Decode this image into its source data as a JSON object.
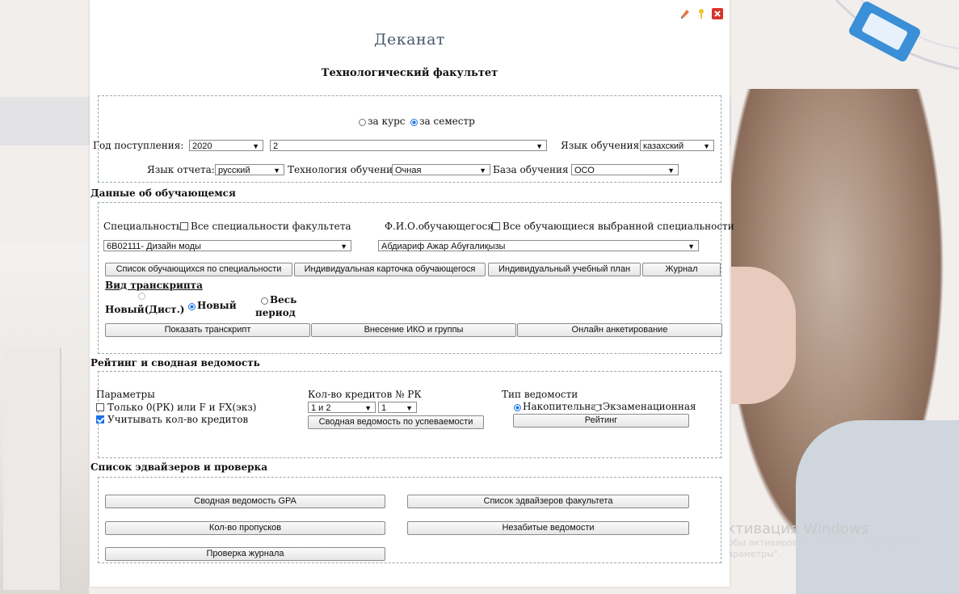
{
  "header": {
    "title": "Деканат",
    "faculty": "Технологический факультет",
    "icons": [
      "pencil-icon",
      "help-icon",
      "close-icon"
    ],
    "close_color": "#d9322a"
  },
  "filters": {
    "period_options": [
      "за курс",
      "за семестр"
    ],
    "period_selected": "за семестр",
    "year_label": "Год поступления:",
    "year_value": "2020",
    "course_value": "2",
    "study_lang_label": "Язык обучения:",
    "study_lang_value": "казахский",
    "report_lang_label": "Язык отчета:",
    "report_lang_value": "русский",
    "tech_label": "Технология обучения",
    "tech_value": "Очная",
    "base_label": "База обучения",
    "base_value": "ОСО"
  },
  "students": {
    "section_title": "Данные об обучающемся",
    "specialty_label": "Специальность",
    "all_specialties_label": "Все специальности факультета",
    "fio_label": "Ф.И.О.обучающегося",
    "all_students_label": "Все обучающиеся выбранной специальности",
    "specialty_value": "6В02111- Дизайн моды",
    "student_value": "Абдиариф Ажар Абуғалиқызы",
    "buttons": [
      "Список обучающихся по специальности",
      "Индивидуальная карточка обучающегося",
      "Индивидуальный учебный план",
      "Журнал"
    ],
    "transcript_title": "Вид транскрипта",
    "transcript_new_dist": "Новый(Дист.)",
    "transcript_new": "Новый",
    "transcript_all_line1": "Весь",
    "transcript_all_line2": "период",
    "transcript_selected": "Новый",
    "buttons2": [
      "Показать транскрипт",
      "Внесение ИКО и группы",
      "Онлайн анкетирование"
    ]
  },
  "rating": {
    "section_title": "Рейтинг и сводная ведомость",
    "params_label": "Параметры",
    "only_zero_label": "Только 0(РК) или F и FX(экз)",
    "only_zero_checked": false,
    "count_credits_label": "Учитывать кол-во кредитов",
    "count_credits_checked": true,
    "credits_label": "Кол-во кредитов № РК",
    "credits_value": "1 и 2",
    "rk_value": "1",
    "summary_button": "Сводная ведомость по успеваемости",
    "type_label": "Тип ведомости",
    "type_options": [
      "Накопительная",
      "Экзаменационная"
    ],
    "type_selected": "Накопительная",
    "rating_button": "Рейтинг"
  },
  "advisers": {
    "section_title": "Список эдвайзеров и проверка",
    "buttons": [
      "Сводная ведомость GPA",
      "Список эдвайзеров факультета",
      "Кол-во пропусков",
      "Незабитые ведомости",
      "Проверка журнала"
    ]
  },
  "watermark": {
    "title": "Активация Windows",
    "line1": "Чтобы активировать Windows, перейдите в",
    "line2": "\"Параметры\"."
  }
}
